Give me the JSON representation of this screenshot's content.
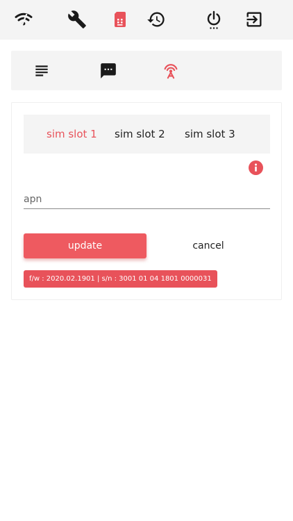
{
  "top_nav": {
    "icons": [
      "wifi-icon",
      "wrench-icon",
      "sim-card-icon",
      "history-icon",
      "power-icon",
      "logout-icon"
    ],
    "active": "sim-card-icon"
  },
  "sub_nav": {
    "icons": [
      "list-icon",
      "message-icon",
      "antenna-icon"
    ],
    "active": "antenna-icon"
  },
  "sim_tabs": [
    {
      "label": "sim slot 1",
      "active": true
    },
    {
      "label": "sim slot 2",
      "active": false
    },
    {
      "label": "sim slot 3",
      "active": false
    }
  ],
  "form": {
    "apn_placeholder": "apn",
    "apn_value": ""
  },
  "buttons": {
    "update": "update",
    "cancel": "cancel"
  },
  "status": {
    "firmware": "f/w : 2020.02.1901 | s/n : 3001 01 04 1801 0000031"
  },
  "colors": {
    "accent": "#e8525a",
    "bar_background": "#f4f4f4",
    "icon": "#1a1a1a"
  }
}
